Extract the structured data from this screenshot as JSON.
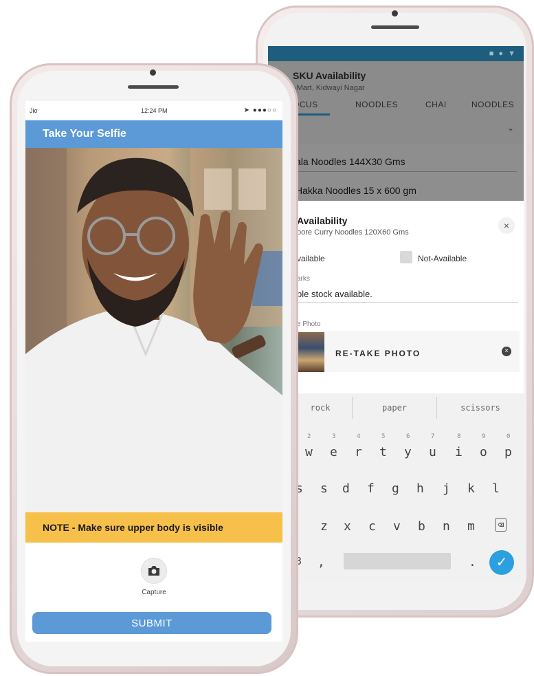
{
  "back_phone": {
    "header": {
      "title": "SKU Availability",
      "subtitle": "D-Mart, Kidwayi Nagar",
      "status_icons": "■ ● ▼"
    },
    "tabs": [
      {
        "label": "OCUS"
      },
      {
        "label": "NOODLES"
      },
      {
        "label": "CHAI"
      },
      {
        "label": "NOODLES"
      }
    ],
    "section_letter": "s",
    "dropdown_glyph": "⌄",
    "list_items": [
      {
        "label": "ala Noodles 144X30 Gms"
      },
      {
        "label": "Hakka Noodles 15 x 600 gm"
      }
    ],
    "sheet": {
      "title": "Availability",
      "subtitle": "pore Curry Noodles 120X60 Gms",
      "close_glyph": "×",
      "available_label": "vailable",
      "not_available_label": "Not-Available",
      "remarks_label": "arks",
      "remarks_value": "ple stock available.",
      "photo_label": "e Photo",
      "retake_label": "RE-TAKE PHOTO",
      "remove_glyph": "×"
    },
    "keyboard": {
      "suggestions": [
        "rock",
        "paper",
        "scissors"
      ],
      "number_hints": [
        "2",
        "3",
        "4",
        "5",
        "6",
        "7",
        "8",
        "9",
        "0"
      ],
      "row1": [
        "w",
        "e",
        "r",
        "t",
        "y",
        "u",
        "i",
        "o",
        "p"
      ],
      "row2": [
        "s",
        "d",
        "f",
        "g",
        "h",
        "j",
        "k",
        "l"
      ],
      "row3": [
        "z",
        "x",
        "c",
        "v",
        "b",
        "n",
        "m"
      ],
      "backspace_glyph": "⌫",
      "bottom_left": "3",
      "comma": ",",
      "period": ".",
      "enter_glyph": "✓"
    }
  },
  "front_phone": {
    "status": {
      "carrier": "Jio",
      "time": "12:24 PM",
      "right_icons": "➤ ●●●○○"
    },
    "header_title": "Take Your Selfie",
    "note": "NOTE - Make sure upper body is visible",
    "capture_icon": "camera-icon",
    "capture_label": "Capture",
    "submit_label": "SUBMIT"
  },
  "colors": {
    "primary_blue": "#5b9ad6",
    "back_status_bar": "#1e5d7d",
    "note_yellow": "#f7c04a",
    "enter_blue": "#2aa0e0",
    "overlay_gray": "#8b8b8b"
  }
}
